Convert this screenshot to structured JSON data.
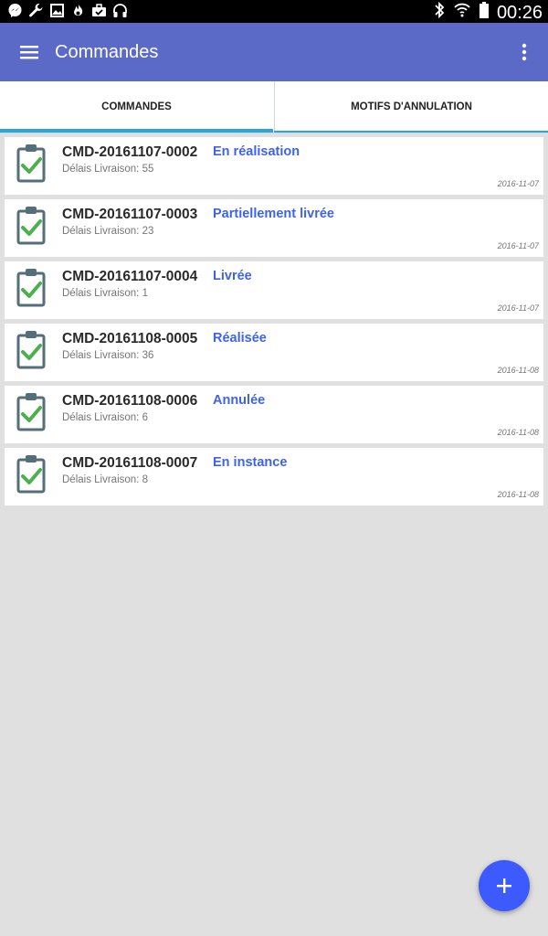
{
  "status_bar": {
    "time": "00:26",
    "left_icons": [
      "messenger-icon",
      "wrench-icon",
      "image-icon",
      "flame-icon",
      "briefcase-icon",
      "headset-icon"
    ],
    "right_icons": [
      "bluetooth-icon",
      "wifi-icon",
      "battery-icon"
    ]
  },
  "app_bar": {
    "title": "Commandes",
    "menu_icon": "menu-icon",
    "more_icon": "more-vert-icon",
    "color": "#5b69c7"
  },
  "tabs": [
    {
      "label": "COMMANDES",
      "selected": true
    },
    {
      "label": "MOTIFS D'ANNULATION",
      "selected": false
    }
  ],
  "orders": [
    {
      "id": "CMD-20161107-0002",
      "status": "En réalisation",
      "delay": "Délais Livraison: 55",
      "date": "2016-11-07"
    },
    {
      "id": "CMD-20161107-0003",
      "status": "Partiellement livrée",
      "delay": "Délais Livraison: 23",
      "date": "2016-11-07"
    },
    {
      "id": "CMD-20161107-0004",
      "status": "Livrée",
      "delay": "Délais Livraison: 1",
      "date": "2016-11-07"
    },
    {
      "id": "CMD-20161108-0005",
      "status": "Réalisée",
      "delay": "Délais Livraison: 36",
      "date": "2016-11-08"
    },
    {
      "id": "CMD-20161108-0006",
      "status": "Annulée",
      "delay": "Délais Livraison: 6",
      "date": "2016-11-08"
    },
    {
      "id": "CMD-20161108-0007",
      "status": "En instance",
      "delay": "Délais Livraison: 8",
      "date": "2016-11-08"
    }
  ],
  "colors": {
    "accent": "#3d5afe",
    "tab_indicator": "#29a7d9",
    "status_text": "#3f63e6",
    "check": "#4caf50"
  },
  "fab": {
    "icon": "add-icon"
  }
}
